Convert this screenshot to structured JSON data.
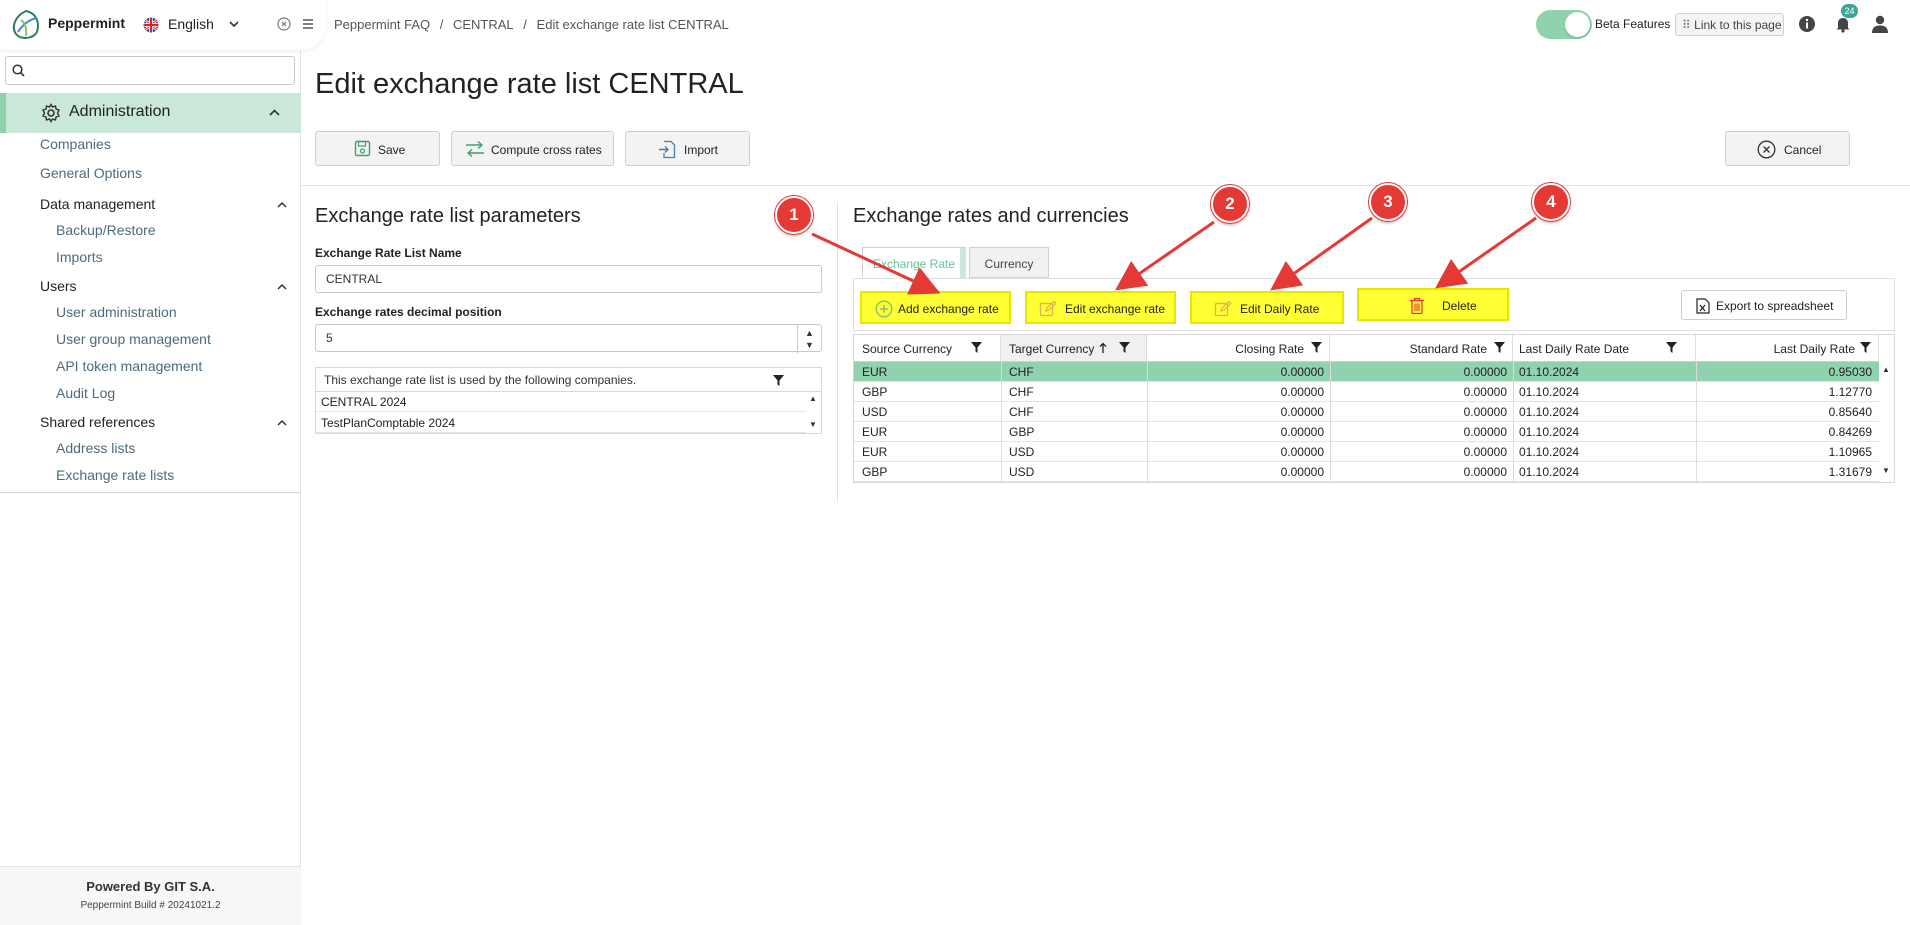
{
  "app": {
    "name": "Peppermint",
    "language": "English",
    "notification_count": "24"
  },
  "sidebar": {
    "search_placeholder": "",
    "section_title": "Administration",
    "items_top": [
      "Companies",
      "General Options"
    ],
    "groups": [
      {
        "title": "Data management",
        "items": [
          "Backup/Restore",
          "Imports"
        ]
      },
      {
        "title": "Users",
        "items": [
          "User administration",
          "User group management",
          "API token management",
          "Audit Log"
        ]
      },
      {
        "title": "Shared references",
        "items": [
          "Address lists",
          "Exchange rate lists"
        ]
      }
    ],
    "footer": {
      "powered_by": "Powered By GIT S.A.",
      "build": "Peppermint Build # 20241021.2"
    }
  },
  "topbar": {
    "breadcrumb": [
      "Peppermint FAQ",
      "/",
      "CENTRAL",
      "/",
      "Edit exchange rate list CENTRAL"
    ],
    "beta_label": "Beta Features",
    "link_label": "Link to this page"
  },
  "page": {
    "title": "Edit exchange rate list CENTRAL",
    "toolbar": {
      "save": "Save",
      "compute": "Compute cross rates",
      "import": "Import",
      "cancel": "Cancel"
    }
  },
  "params": {
    "title": "Exchange rate list parameters",
    "name_label": "Exchange Rate List Name",
    "name_value": "CENTRAL",
    "decimal_label": "Exchange rates decimal position",
    "decimal_value": "5",
    "companies_header": "This exchange rate list is used by the following companies.",
    "companies": [
      "CENTRAL 2024",
      "TestPlanComptable 2024"
    ]
  },
  "rates": {
    "title": "Exchange rates and currencies",
    "tabs": [
      "Exchange Rate",
      "Currency"
    ],
    "actions": {
      "add": "Add exchange rate",
      "edit": "Edit exchange rate",
      "daily": "Edit Daily Rate",
      "delete": "Delete",
      "export": "Export to spreadsheet"
    },
    "columns": [
      "Source Currency",
      "Target Currency",
      "Closing Rate",
      "Standard Rate",
      "Last Daily Rate Date",
      "Last Daily Rate"
    ],
    "rows": [
      [
        "EUR",
        "CHF",
        "0.00000",
        "0.00000",
        "01.10.2024",
        "0.95030"
      ],
      [
        "GBP",
        "CHF",
        "0.00000",
        "0.00000",
        "01.10.2024",
        "1.12770"
      ],
      [
        "USD",
        "CHF",
        "0.00000",
        "0.00000",
        "01.10.2024",
        "0.85640"
      ],
      [
        "EUR",
        "GBP",
        "0.00000",
        "0.00000",
        "01.10.2024",
        "0.84269"
      ],
      [
        "EUR",
        "USD",
        "0.00000",
        "0.00000",
        "01.10.2024",
        "1.10965"
      ],
      [
        "GBP",
        "USD",
        "0.00000",
        "0.00000",
        "01.10.2024",
        "1.31679"
      ]
    ]
  },
  "callouts": [
    "1",
    "2",
    "3",
    "4"
  ],
  "colors": {
    "accent": "#8fd2ad",
    "highlight": "#ffff33",
    "callout": "#e53935",
    "selected_row": "#8fd2ad"
  }
}
